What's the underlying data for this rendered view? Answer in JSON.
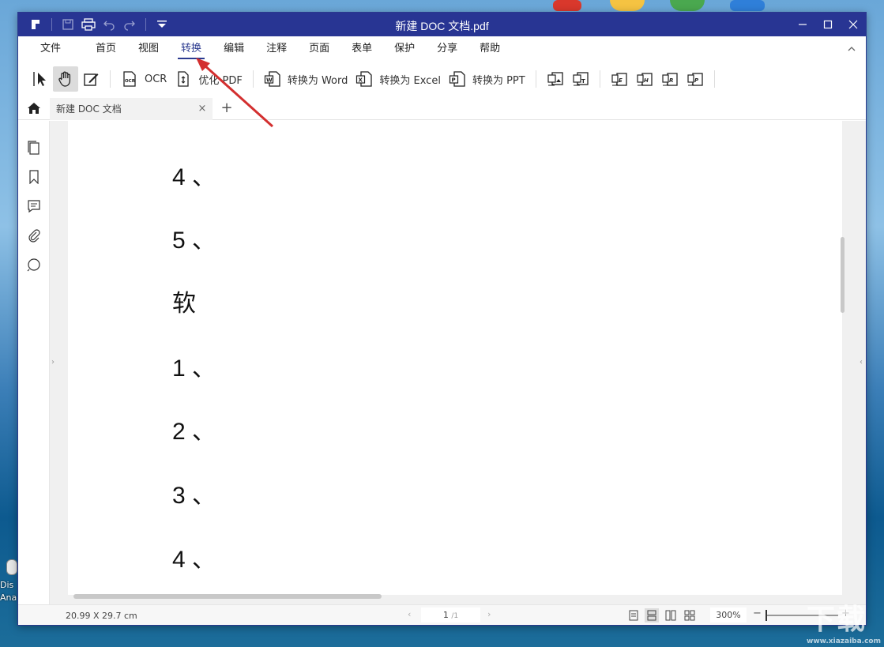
{
  "window": {
    "title": "新建 DOC 文档.pdf"
  },
  "menu": {
    "items": [
      "文件",
      "首页",
      "视图",
      "转换",
      "编辑",
      "注释",
      "页面",
      "表单",
      "保护",
      "分享",
      "帮助"
    ],
    "active": "转换"
  },
  "toolbar": {
    "ocr_label": "OCR",
    "optimize_label": "优化 PDF",
    "to_word_label": "转换为 Word",
    "to_excel_label": "转换为 Excel",
    "to_ppt_label": "转换为 PPT"
  },
  "tabs": {
    "doc_tab_label": "新建 DOC 文档",
    "close_symbol": "×",
    "add_symbol": "+"
  },
  "document": {
    "lines": [
      "4 、",
      "5 、",
      "软",
      "1 、",
      "2 、",
      "3 、",
      "4 、"
    ]
  },
  "status": {
    "page_size": "20.99 X 29.7 cm",
    "current_page": "1",
    "total_pages": "/1",
    "zoom": "300%"
  },
  "desktop": {
    "icon_label_1": "Dis",
    "icon_label_2": "Ana"
  },
  "colors": {
    "titlebar": "#283593",
    "accent": "#2b3a8f",
    "annotation_arrow": "#d32f2f"
  }
}
